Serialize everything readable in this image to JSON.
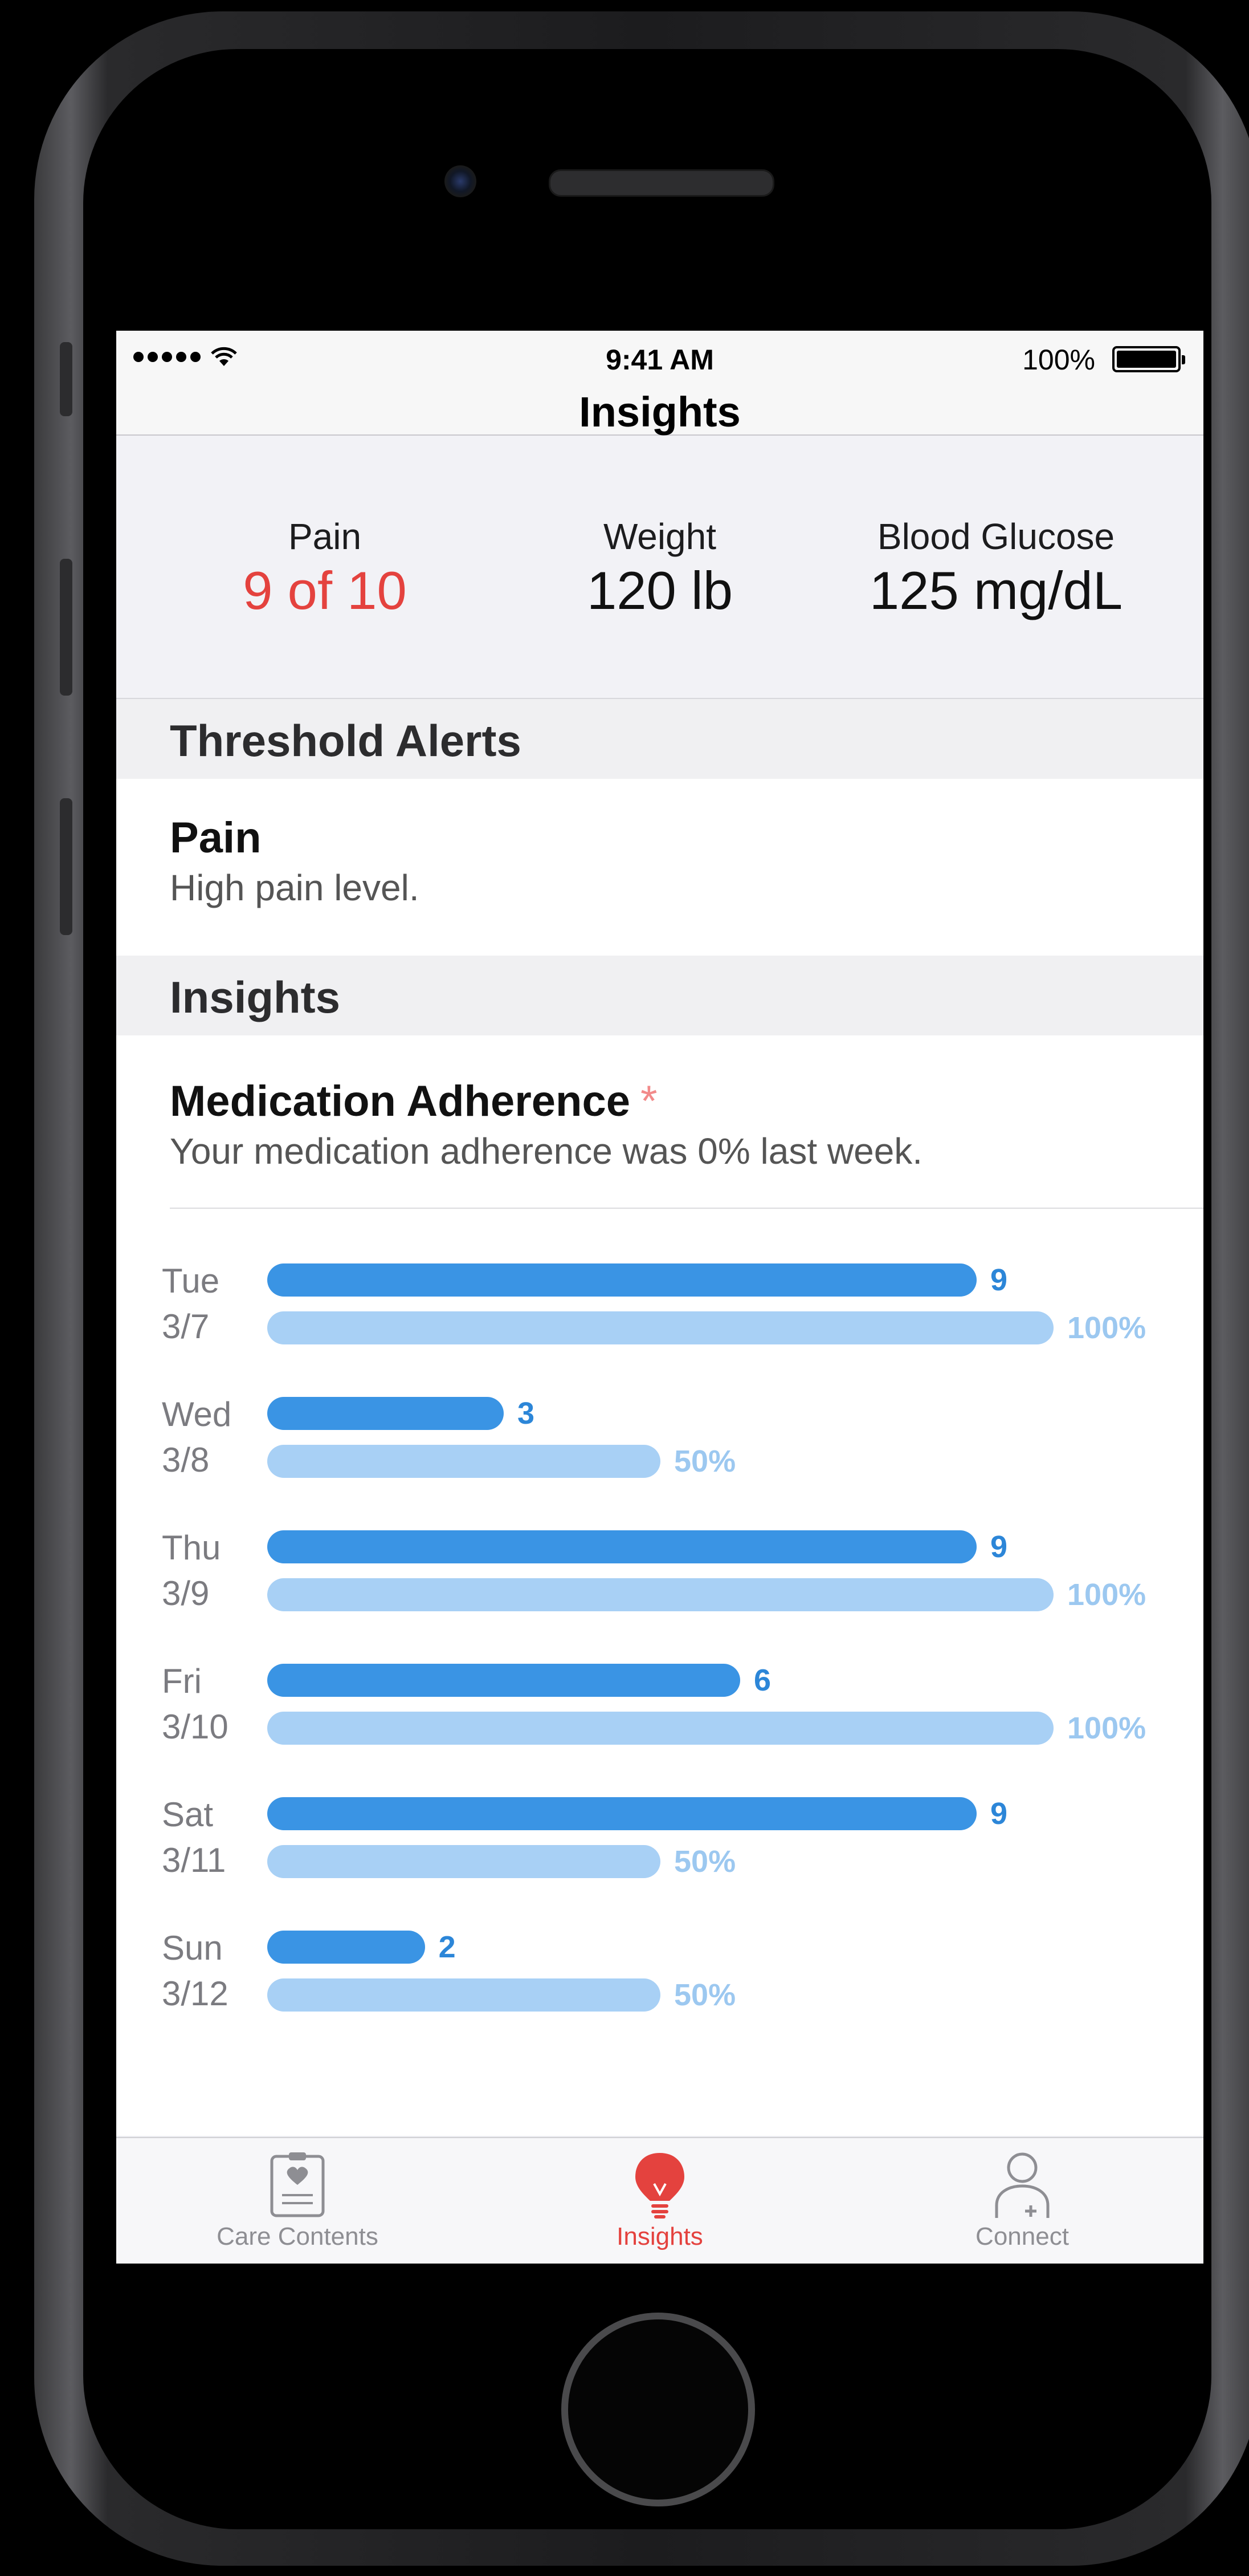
{
  "status_bar": {
    "time": "9:41 AM",
    "battery": "100%"
  },
  "nav": {
    "title": "Insights"
  },
  "summary": [
    {
      "label": "Pain",
      "value": "9 of 10",
      "alert": true
    },
    {
      "label": "Weight",
      "value": "120 lb",
      "alert": false
    },
    {
      "label": "Blood Glucose",
      "value": "125 mg/dL",
      "alert": false
    }
  ],
  "threshold_section": {
    "title": "Threshold Alerts"
  },
  "threshold_alert": {
    "title": "Pain",
    "subtitle": "High pain level."
  },
  "insights_section": {
    "title": "Insights"
  },
  "insight": {
    "title": "Medication Adherence",
    "asterisk": "*",
    "subtitle": "Your medication adherence was 0% last week."
  },
  "chart_data": {
    "type": "bar",
    "categories": [
      "Tue 3/7",
      "Wed 3/8",
      "Thu 3/9",
      "Fri 3/10",
      "Sat 3/11",
      "Sun 3/12"
    ],
    "days": [
      {
        "day": "Tue",
        "date": "3/7"
      },
      {
        "day": "Wed",
        "date": "3/8"
      },
      {
        "day": "Thu",
        "date": "3/9"
      },
      {
        "day": "Fri",
        "date": "3/10"
      },
      {
        "day": "Sat",
        "date": "3/11"
      },
      {
        "day": "Sun",
        "date": "3/12"
      }
    ],
    "series": [
      {
        "values": [
          9,
          3,
          9,
          6,
          9,
          2
        ],
        "labels": [
          "9",
          "3",
          "9",
          "6",
          "9",
          "2"
        ],
        "color": "#3a94e4"
      },
      {
        "values": [
          100,
          50,
          100,
          100,
          50,
          50
        ],
        "labels": [
          "100%",
          "50%",
          "100%",
          "100%",
          "50%",
          "50%"
        ],
        "color": "#a8d0f5"
      }
    ],
    "primary_max": 9,
    "secondary_max": 100
  },
  "tabs": [
    {
      "label": "Care Contents",
      "icon": "clipboard-heart-icon",
      "active": false
    },
    {
      "label": "Insights",
      "icon": "lightbulb-icon",
      "active": true
    },
    {
      "label": "Connect",
      "icon": "person-plus-icon",
      "active": false
    }
  ],
  "colors": {
    "accent": "#e4423e",
    "bar_primary": "#3a94e4",
    "bar_secondary": "#a8d0f5"
  }
}
